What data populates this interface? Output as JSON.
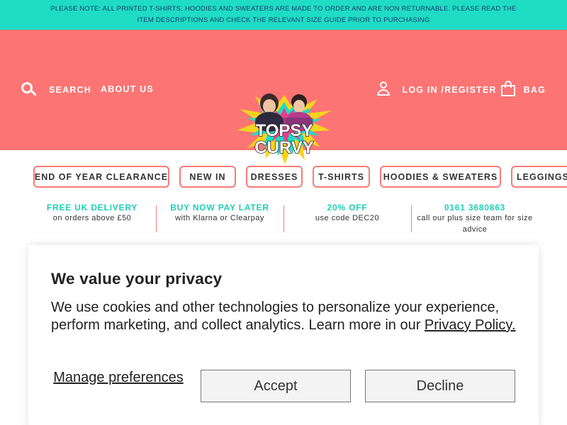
{
  "notice": {
    "text": "PLEASE NOTE: ALL PRINTED T-SHIRTS, HOODIES AND SWEATERS ARE MADE TO ORDER AND ARE NON RETURNABLE. PLEASE READ THE ITEM DESCRIPTIONS AND CHECK THE RELEVANT SIZE GUIDE PRIOR TO PURCHASING"
  },
  "header": {
    "search_label": "SEARCH",
    "about_label": "ABOUT US",
    "logo_line1": "TOPSY",
    "logo_line2": "CURVY",
    "login_label": "LOG IN /REGISTER",
    "bag_label": "BAG"
  },
  "categories": [
    "END OF YEAR CLEARANCE",
    "NEW IN",
    "DRESSES",
    "T-SHIRTS",
    "HOODIES & SWEATERS",
    "LEGGINGS"
  ],
  "usps": [
    {
      "title": "FREE UK DELIVERY",
      "sub": "on orders above £50"
    },
    {
      "title": "BUY NOW PAY LATER",
      "sub": "with Klarna or Clearpay"
    },
    {
      "title": "20% OFF",
      "sub": "use code DEC20"
    },
    {
      "title": "0161 3680863",
      "sub": "call our plus size team for size advice"
    }
  ],
  "consent": {
    "title": "We value your privacy",
    "body": "We use cookies and other technologies to personalize your experience, perform marketing, and collect analytics. Learn more in our ",
    "link": "Privacy Policy.",
    "manage_label": "Manage preferences",
    "accept_label": "Accept",
    "decline_label": "Decline"
  },
  "colors": {
    "notice_bg": "#1fdcc4",
    "header_bg": "#fd7474",
    "accent_teal": "#1fcfb6",
    "pill_border": "#f87a7a"
  }
}
